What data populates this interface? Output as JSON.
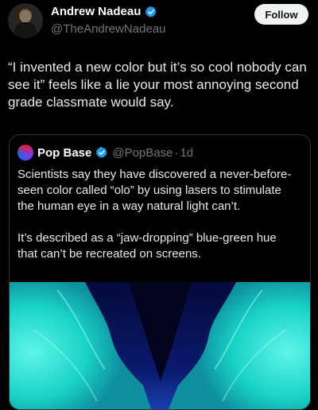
{
  "author": {
    "name": "Andrew Nadeau",
    "handle": "@TheAndrewNadeau",
    "verified_icon": "verified-badge-icon",
    "badge_color": "#1d9bf0"
  },
  "follow_label": "Follow",
  "tweet_text": "“I invented a new color but it’s so cool nobody can see it” feels like a lie your most annoying second grade classmate would say.",
  "quote": {
    "name": "Pop Base",
    "handle": "@PopBase",
    "separator": "·",
    "time": "1d",
    "paragraph1": "Scientists say they have discovered a never-before-seen color called “olo” by using lasers to stimulate the human eye in a way natural light can’t.",
    "paragraph2": "It’s described as a “jaw-dropping” blue-green hue that can’t be recreated on screens."
  },
  "colors": {
    "background": "#000000",
    "text": "#e7e9ea",
    "secondary": "#71767b",
    "border": "#2f3336",
    "teal": "#19d3c5",
    "deep_blue": "#0a1a6e"
  }
}
